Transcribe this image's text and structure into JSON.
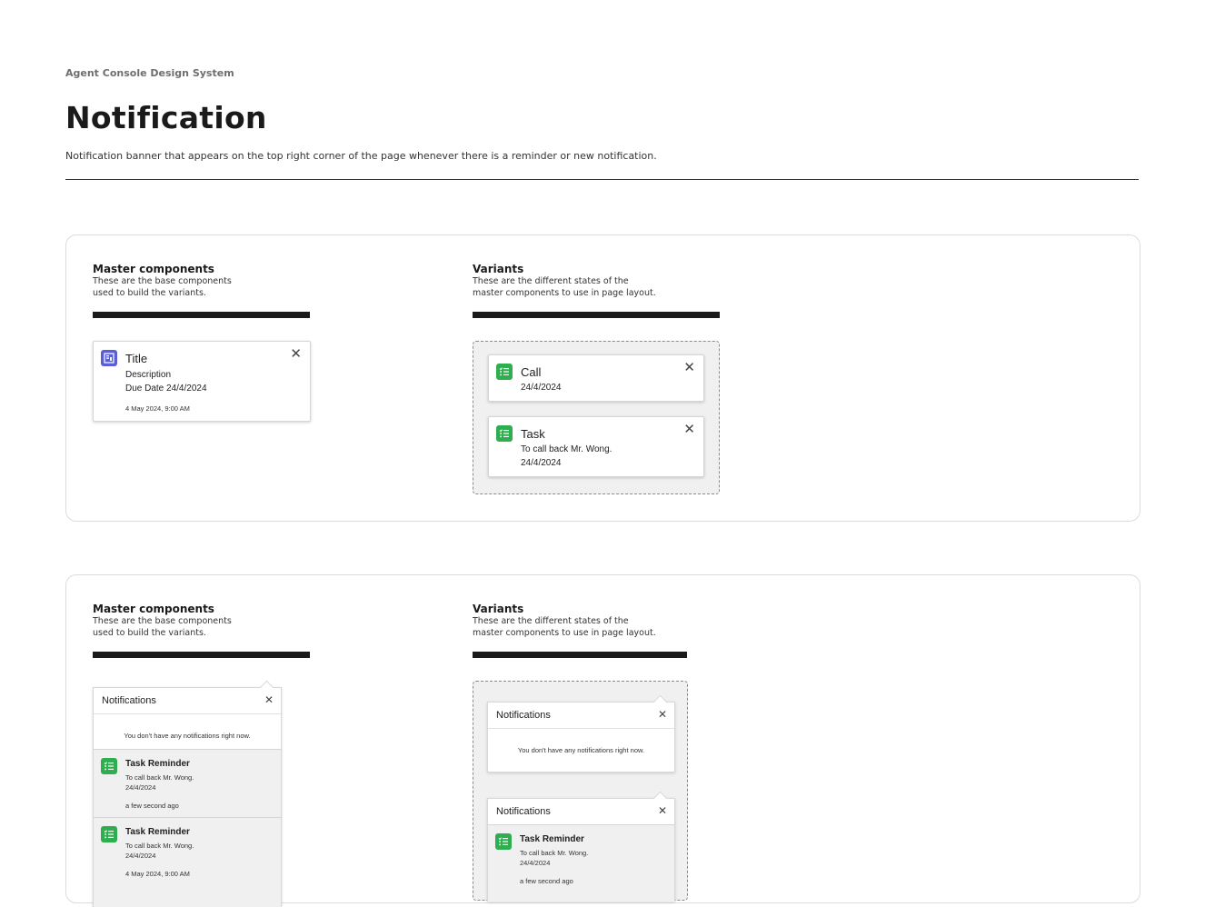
{
  "header": {
    "kicker": "Agent Console Design System",
    "title": "Notification",
    "description": "Notification banner that appears on the top right corner of the page whenever there is a reminder or new notification."
  },
  "section1": {
    "master": {
      "title": "Master components",
      "sub1": "These are the base components",
      "sub2": "used to build the variants."
    },
    "variants": {
      "title": "Variants",
      "sub1": "These are the different states of the",
      "sub2": "master components to use in page layout."
    },
    "master_card": {
      "title": "Title",
      "description": "Description",
      "due": "Due Date 24/4/2024",
      "timestamp": "4 May 2024, 9:00 AM",
      "icon": "clipboard-icon",
      "close": "✕"
    },
    "variant_call": {
      "title": "Call",
      "date": "24/4/2024",
      "icon": "checklist-icon",
      "close": "✕"
    },
    "variant_task": {
      "title": "Task",
      "line1": "To call back Mr. Wong.",
      "date": "24/4/2024",
      "icon": "checklist-icon",
      "close": "✕"
    }
  },
  "section2": {
    "master": {
      "title": "Master components",
      "sub1": "These are the base components",
      "sub2": "used to build the variants."
    },
    "variants": {
      "title": "Variants",
      "sub1": "These are the different states of the",
      "sub2": "master components to use in page layout."
    },
    "master_panel": {
      "title": "Notifications",
      "close": "✕",
      "empty": "You don't have any notifications right now.",
      "items": [
        {
          "title": "Task Reminder",
          "line1": "To call back Mr. Wong.",
          "date": "24/4/2024",
          "time": "a few second ago"
        },
        {
          "title": "Task Reminder",
          "line1": "To call back Mr. Wong.",
          "date": "24/4/2024",
          "time": "4 May 2024, 9:00 AM"
        }
      ]
    },
    "variant_empty": {
      "title": "Notifications",
      "close": "✕",
      "empty": "You don't have any notifications right now."
    },
    "variant_list": {
      "title": "Notifications",
      "close": "✕",
      "items": [
        {
          "title": "Task Reminder",
          "line1": "To call back Mr. Wong.",
          "date": "24/4/2024",
          "time": "a few second ago"
        }
      ]
    }
  },
  "colors": {
    "accent_green": "#2eae4f",
    "accent_blue": "#5a5fd6",
    "text": "#1f1f1f",
    "divider": "#333333"
  }
}
